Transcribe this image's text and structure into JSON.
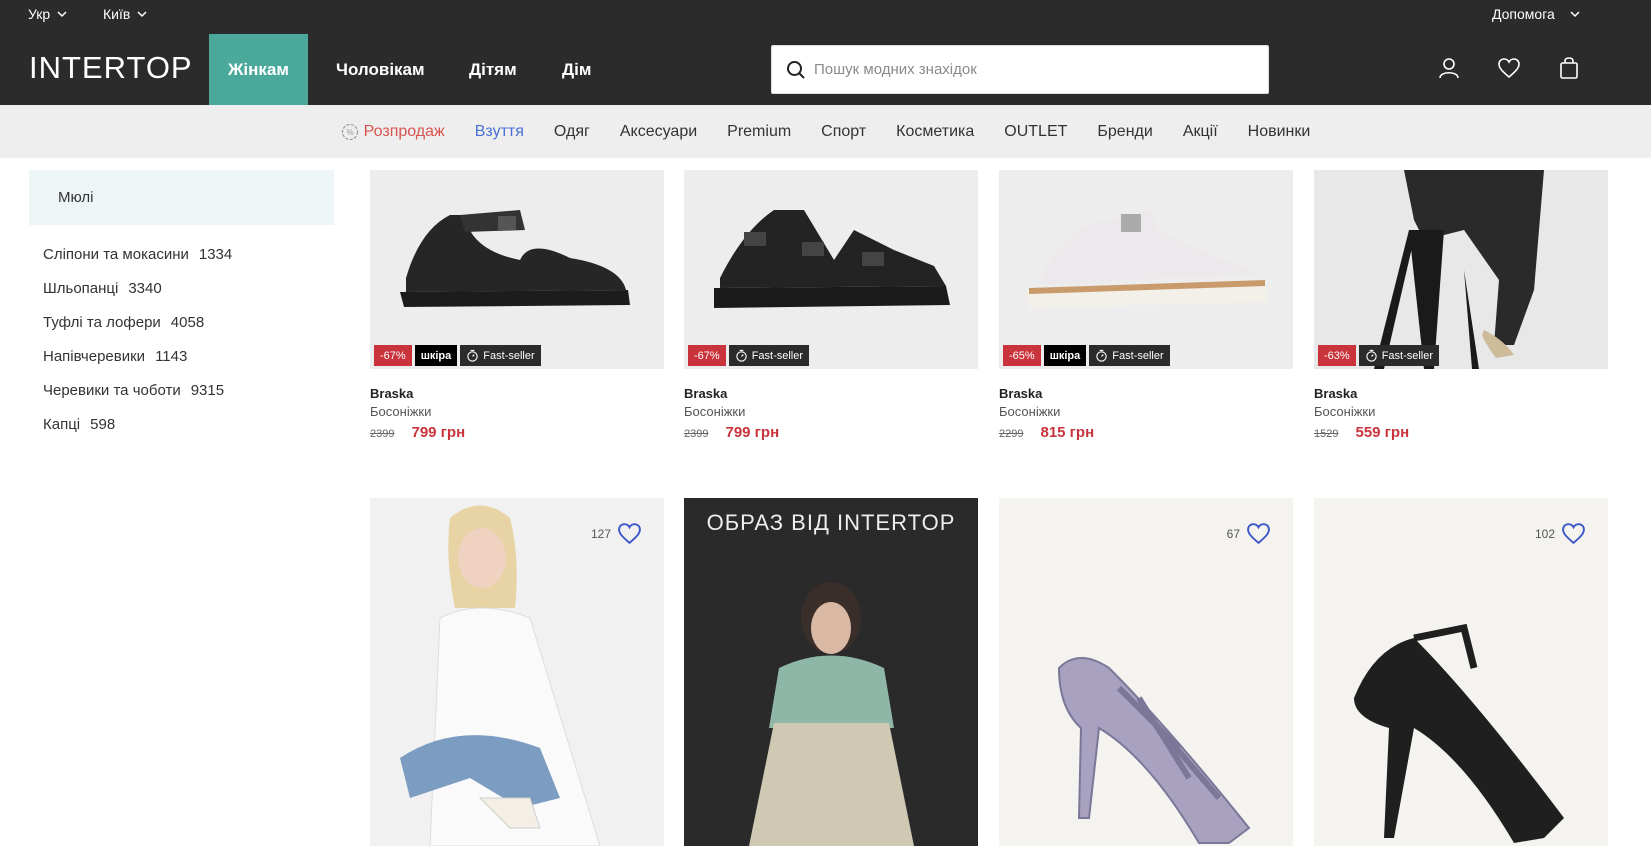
{
  "util": {
    "lang": "Укр",
    "city": "Київ",
    "help": "Допомога"
  },
  "logo": "INTERTOP",
  "nav": [
    {
      "label": "Жінкам",
      "active": true
    },
    {
      "label": "Чоловікам"
    },
    {
      "label": "Дітям"
    },
    {
      "label": "Дім"
    }
  ],
  "search": {
    "placeholder": "Пошук модних знахідок"
  },
  "categories": [
    {
      "label": "Розпродаж",
      "type": "sale"
    },
    {
      "label": "Взуття",
      "type": "active"
    },
    {
      "label": "Одяг"
    },
    {
      "label": "Аксесуари"
    },
    {
      "label": "Premium"
    },
    {
      "label": "Спорт"
    },
    {
      "label": "Косметика"
    },
    {
      "label": "OUTLET"
    },
    {
      "label": "Бренди"
    },
    {
      "label": "Акції"
    },
    {
      "label": "Новинки"
    }
  ],
  "sidebar": {
    "header": "Мюлі",
    "items": [
      {
        "label": "Сліпони та мокасини",
        "count": "1334"
      },
      {
        "label": "Шльопанці",
        "count": "3340"
      },
      {
        "label": "Туфлі та лофери",
        "count": "4058"
      },
      {
        "label": "Напівчеревики",
        "count": "1143"
      },
      {
        "label": "Черевики та чоботи",
        "count": "9315"
      },
      {
        "label": "Капці",
        "count": "598"
      }
    ]
  },
  "products": [
    {
      "brand": "Braska",
      "type": "Босоніжки",
      "old": "2399",
      "price": "799 грн",
      "discount": "-67%",
      "leather": "шкіра",
      "fast": "Fast-seller"
    },
    {
      "brand": "Braska",
      "type": "Босоніжки",
      "old": "2399",
      "price": "799 грн",
      "discount": "-67%",
      "fast": "Fast-seller"
    },
    {
      "brand": "Braska",
      "type": "Босоніжки",
      "old": "2299",
      "price": "815 грн",
      "discount": "-65%",
      "leather": "шкіра",
      "fast": "Fast-seller"
    },
    {
      "brand": "Braska",
      "type": "Босоніжки",
      "old": "1529",
      "price": "559 грн",
      "discount": "-63%",
      "fast": "Fast-seller"
    }
  ],
  "row2": {
    "likes1": "127",
    "promo": "ОБРАЗ ВІД INTERTOP",
    "likes3": "67",
    "likes4": "102"
  }
}
